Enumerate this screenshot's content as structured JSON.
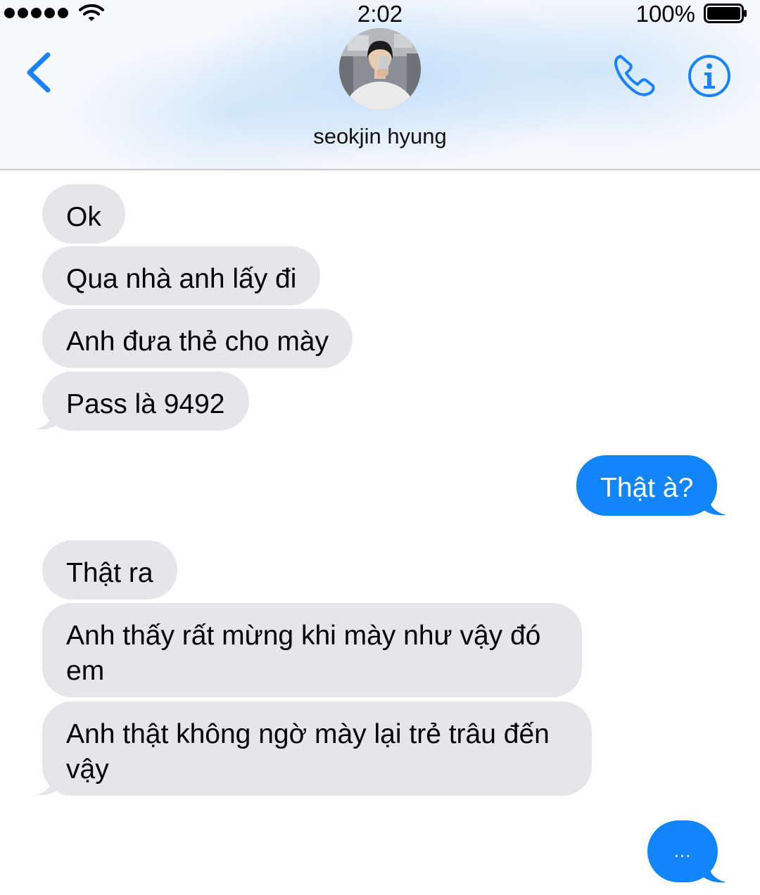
{
  "status_bar": {
    "time": "2:02",
    "battery": "100%",
    "signal_icon": "signal-dots-icon",
    "wifi_icon": "wifi-icon",
    "battery_icon": "battery-full-icon"
  },
  "header": {
    "contact_name": "seokjin hyung",
    "back_icon": "chevron-left-icon",
    "call_icon": "phone-icon",
    "info_icon": "info-icon",
    "accent_color": "#1a82fb"
  },
  "messages": [
    {
      "from": "contact",
      "text": "Ok"
    },
    {
      "from": "contact",
      "text": "Qua nhà anh lấy đi"
    },
    {
      "from": "contact",
      "text": "Anh đưa thẻ cho mày"
    },
    {
      "from": "contact",
      "text": "Pass là 9492"
    },
    {
      "from": "me",
      "text": "Thật à?"
    },
    {
      "from": "contact",
      "text": "Thật ra"
    },
    {
      "from": "contact",
      "text": "Anh thấy rất mừng khi mày như vậy đó em"
    },
    {
      "from": "contact",
      "text": "Anh thật không ngờ mày lại trẻ trâu đến vậy"
    }
  ],
  "typing_indicator": {
    "from": "me",
    "text": "..."
  },
  "colors": {
    "incoming_bubble": "#e5e5ea",
    "outgoing_bubble": "#1285fb"
  }
}
